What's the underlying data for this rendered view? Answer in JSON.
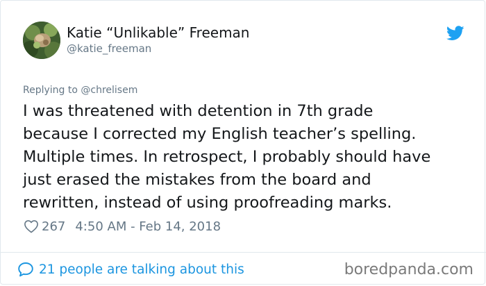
{
  "author": {
    "display_name": "Katie “Unlikable” Freeman",
    "handle": "@katie_freeman"
  },
  "reply": {
    "prefix": "Replying to",
    "mention": "@chrelisem"
  },
  "tweet": {
    "lines": [
      "I was threatened with detention in 7th grade",
      "because I corrected my English teacher’s spelling.",
      "Multiple times. In retrospect, I probably should have",
      "just erased the mistakes from the board and",
      "rewritten, instead of using proofreading marks."
    ]
  },
  "meta": {
    "likes": "267",
    "timestamp": "4:50 AM - Feb 14, 2018"
  },
  "footer": {
    "talking": "21 people are talking about this"
  },
  "watermark": "boredpanda.com",
  "icons": {
    "bird": "twitter-bird-icon",
    "heart": "heart-outline-icon",
    "bubble": "speech-bubble-icon"
  },
  "colors": {
    "twitter_blue": "#1da1f2",
    "link_blue": "#1b95e0",
    "secondary_text": "#657786",
    "primary_text": "#14171a"
  }
}
